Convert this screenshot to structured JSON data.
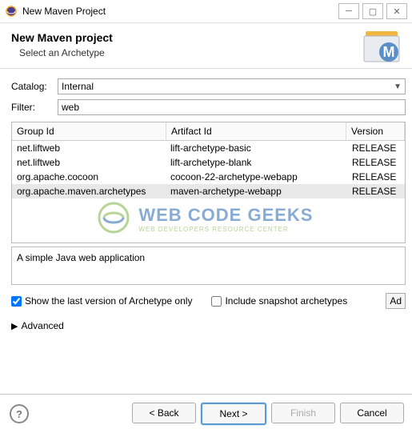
{
  "window": {
    "title": "New Maven Project"
  },
  "header": {
    "title": "New Maven project",
    "subtitle": "Select an Archetype"
  },
  "catalog": {
    "label": "Catalog:",
    "value": "Internal"
  },
  "filter": {
    "label": "Filter:",
    "value": "web"
  },
  "columns": {
    "group": "Group Id",
    "artifact": "Artifact Id",
    "version": "Version"
  },
  "rows": [
    {
      "group": "net.liftweb",
      "artifact": "lift-archetype-basic",
      "version": "RELEASE",
      "selected": false
    },
    {
      "group": "net.liftweb",
      "artifact": "lift-archetype-blank",
      "version": "RELEASE",
      "selected": false
    },
    {
      "group": "org.apache.cocoon",
      "artifact": "cocoon-22-archetype-webapp",
      "version": "RELEASE",
      "selected": false
    },
    {
      "group": "org.apache.maven.archetypes",
      "artifact": "maven-archetype-webapp",
      "version": "RELEASE",
      "selected": true
    }
  ],
  "description": "A simple Java web application",
  "options": {
    "show_last": {
      "label": "Show the last version of Archetype only",
      "checked": true
    },
    "include_snapshot": {
      "label": "Include snapshot archetypes",
      "checked": false
    },
    "add_button": "Ad"
  },
  "advanced": "Advanced",
  "buttons": {
    "back": "< Back",
    "next": "Next >",
    "finish": "Finish",
    "cancel": "Cancel"
  },
  "watermark": {
    "title": "WEB CODE GEEKS",
    "subtitle": "WEB DEVELOPERS RESOURCE CENTER"
  }
}
